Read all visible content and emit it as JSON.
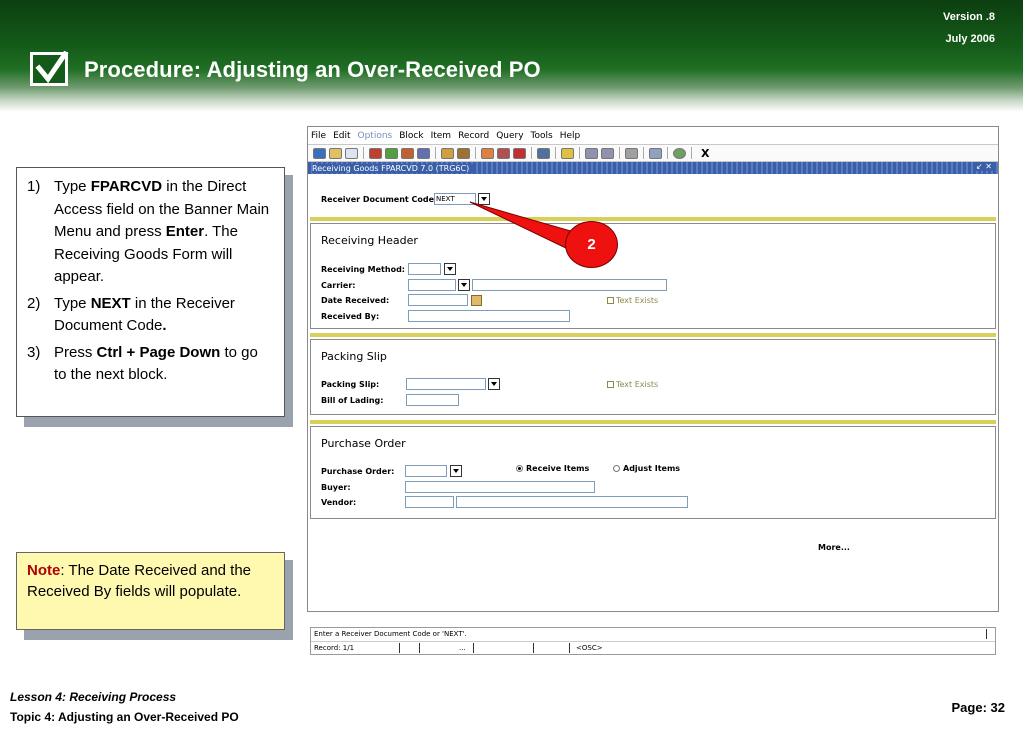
{
  "header": {
    "version": "Version .8",
    "date": "July  2006",
    "title": "Procedure:  Adjusting an Over-Received PO"
  },
  "steps": [
    {
      "num": "1)",
      "parts": [
        "Type ",
        "FPARCVD",
        " in the Direct Access field on the Banner Main Menu and press ",
        "Enter",
        ". The Receiving Goods Form will appear."
      ]
    },
    {
      "num": "2)",
      "parts": [
        "Type ",
        "NEXT",
        " in the Receiver Document Code",
        ".",
        ""
      ]
    },
    {
      "num": "3)",
      "parts": [
        "Press ",
        "Ctrl + Page Down",
        " to go to the next block.",
        "",
        ""
      ]
    }
  ],
  "note": {
    "label": "Note",
    "text": ": The Date Received and the Received By fields will populate."
  },
  "app": {
    "menu": [
      "File",
      "Edit",
      "Options",
      "Block",
      "Item",
      "Record",
      "Query",
      "Tools",
      "Help"
    ],
    "exit_label": "X",
    "form_title": "Receiving Goods  FPARCVD  7.0  (TRG6C)",
    "window_controls": "↙ ✕",
    "receiver_code_label": "Receiver Document Code",
    "receiver_code_value": "NEXT",
    "receiving_header": {
      "title": "Receiving Header",
      "method_label": "Receiving Method:",
      "carrier_label": "Carrier:",
      "date_label": "Date Received:",
      "received_by_label": "Received By:",
      "text_exists": "Text Exists"
    },
    "packing_slip": {
      "title": "Packing Slip",
      "slip_label": "Packing Slip:",
      "lading_label": "Bill of Lading:",
      "text_exists": "Text Exists"
    },
    "purchase_order": {
      "title": "Purchase Order",
      "po_label": "Purchase Order:",
      "receive_items": "Receive Items",
      "adjust_items": "Adjust Items",
      "buyer_label": "Buyer:",
      "vendor_label": "Vendor:"
    },
    "more": "More...",
    "status": {
      "message": "Enter a Receiver Document Code or 'NEXT'.",
      "record": "Record: 1/1",
      "dots": "...",
      "osc": "<OSC>"
    }
  },
  "callout": "2",
  "footer": {
    "lesson": "Lesson 4: Receiving Process",
    "topic": "Topic 4: Adjusting an Over-Received PO",
    "page": "Page: 32"
  }
}
